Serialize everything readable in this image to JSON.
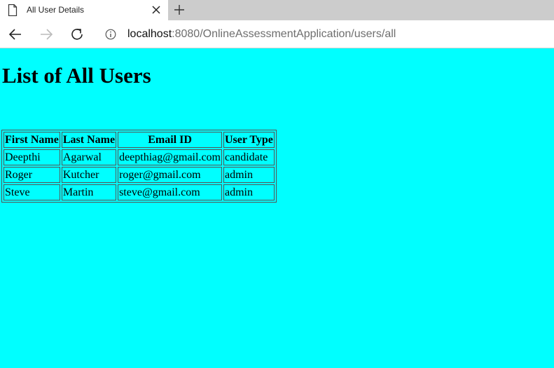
{
  "browser": {
    "tab_title": "All User Details",
    "url_host": "localhost",
    "url_path": ":8080/OnlineAssessmentApplication/users/all",
    "icons": [
      "page-icon",
      "close-icon",
      "new-tab-icon",
      "back-icon",
      "forward-icon",
      "reload-icon",
      "info-icon"
    ]
  },
  "page": {
    "heading": "List of All Users",
    "background_color": "#00ffff",
    "table": {
      "headers": [
        "First Name",
        "Last Name",
        "Email ID",
        "User Type"
      ],
      "rows": [
        [
          "Deepthi",
          "Agarwal",
          "deepthiag@gmail.com",
          "candidate"
        ],
        [
          "Roger",
          "Kutcher",
          "roger@gmail.com",
          "admin"
        ],
        [
          "Steve",
          "Martin",
          "steve@gmail.com",
          "admin"
        ]
      ]
    }
  }
}
